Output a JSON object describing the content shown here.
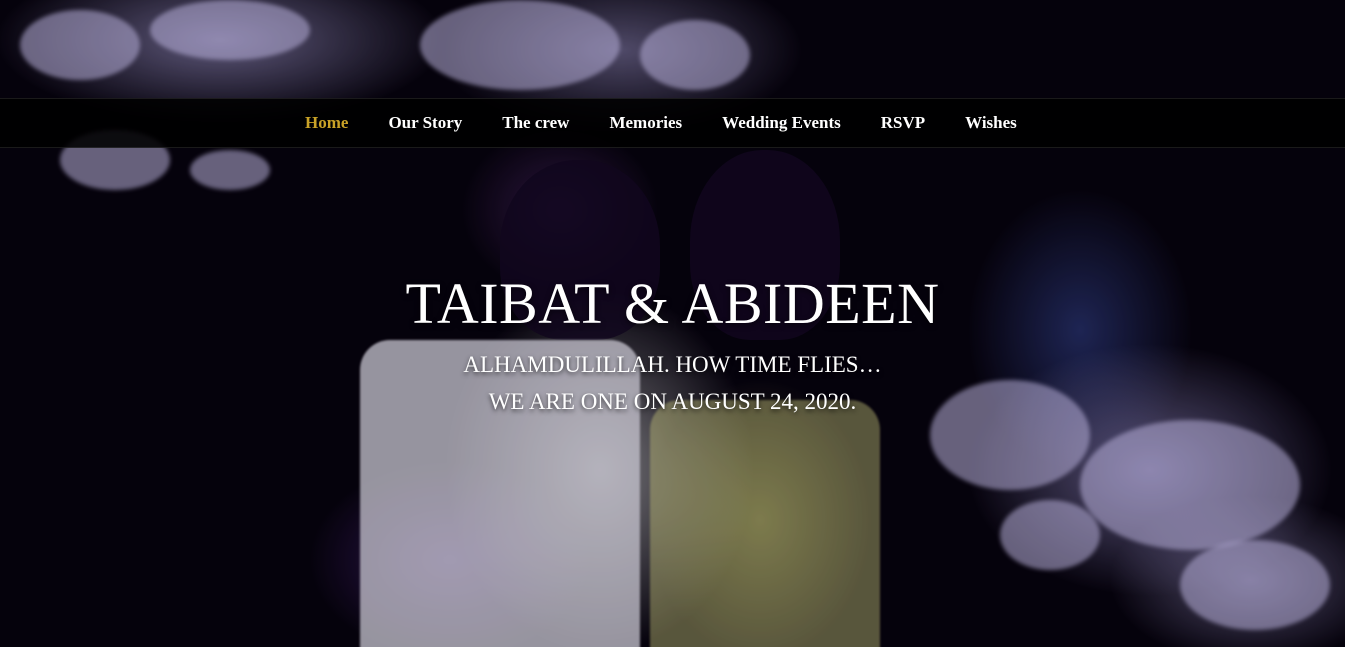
{
  "nav": {
    "items": [
      {
        "label": "Home",
        "active": true
      },
      {
        "label": "Our Story",
        "active": false
      },
      {
        "label": "The crew",
        "active": false
      },
      {
        "label": "Memories",
        "active": false
      },
      {
        "label": "Wedding Events",
        "active": false
      },
      {
        "label": "RSVP",
        "active": false
      },
      {
        "label": "Wishes",
        "active": false
      }
    ],
    "active_color": "#c9a227",
    "text_color": "#ffffff"
  },
  "hero": {
    "title": "TAIBAT & ABIDEEN",
    "line1": "ALHAMDULILLAH. HOW TIME FLIES…",
    "line2": "WE ARE ONE ON AUGUST 24, 2020."
  }
}
